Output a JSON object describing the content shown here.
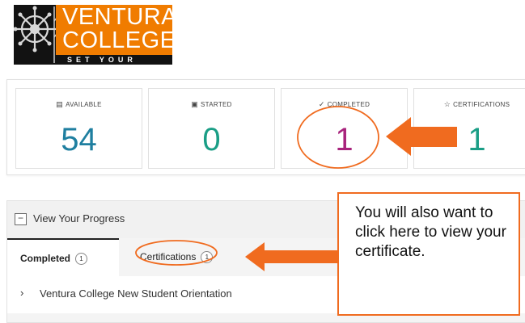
{
  "logo": {
    "line1": "VENTURA",
    "line2": "COLLEGE",
    "tagline": "SET YOUR COURSE"
  },
  "stats": [
    {
      "label": "AVAILABLE",
      "icon": "book-icon",
      "glyph": "▤",
      "value": "54",
      "color": "#1f7fa0"
    },
    {
      "label": "STARTED",
      "icon": "briefcase-icon",
      "glyph": "▣",
      "value": "0",
      "color": "#1a9e86"
    },
    {
      "label": "COMPLETED",
      "icon": "check-icon",
      "glyph": "✓",
      "value": "1",
      "color": "#a8237c"
    },
    {
      "label": "CERTIFICATIONS",
      "icon": "star-icon",
      "glyph": "☆",
      "value": "1",
      "color": "#1a9e86"
    }
  ],
  "progress": {
    "title": "View Your Progress",
    "collapse_glyph": "−",
    "tabs": [
      {
        "label": "Completed",
        "count": "1"
      },
      {
        "label": "Certifications",
        "count": "1"
      }
    ],
    "items": [
      {
        "chevron": "›",
        "label": "Ventura College New Student Orientation"
      }
    ]
  },
  "callout": {
    "text": "You will also want to click here to view your certificate."
  },
  "annotation_color": "#f06b1f"
}
